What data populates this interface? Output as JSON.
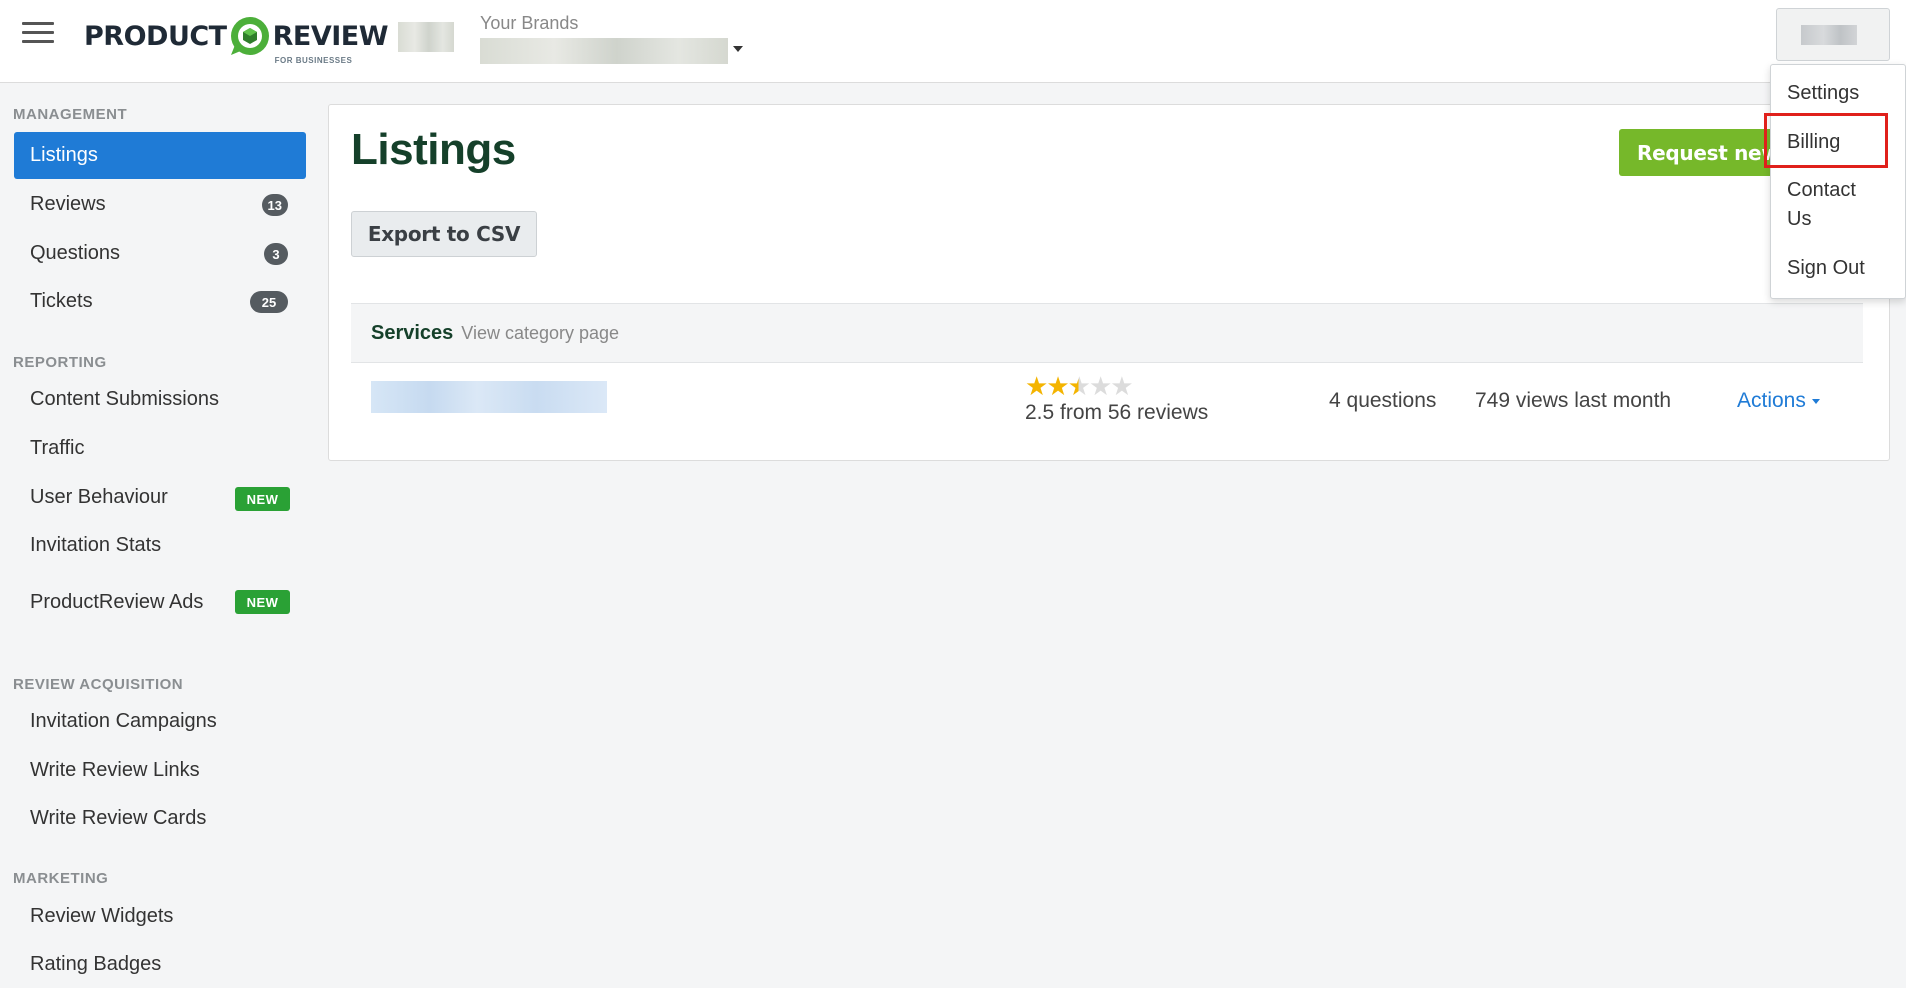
{
  "header": {
    "logo_left": "PRODUCT",
    "logo_right": "REVIEW",
    "logo_sub": "FOR BUSINESSES",
    "brands_label": "Your Brands"
  },
  "sidebar": {
    "sections": [
      {
        "title": "MANAGEMENT"
      },
      {
        "title": "REPORTING"
      },
      {
        "title": "REVIEW ACQUISITION"
      },
      {
        "title": "MARKETING"
      }
    ],
    "items": {
      "listings": "Listings",
      "reviews": "Reviews",
      "reviews_count": "13",
      "questions": "Questions",
      "questions_count": "3",
      "tickets": "Tickets",
      "tickets_count": "25",
      "content_submissions": "Content Submissions",
      "traffic": "Traffic",
      "user_behaviour": "User Behaviour",
      "invitation_stats": "Invitation Stats",
      "productreview_ads": "ProductReview Ads",
      "new_badge": "NEW",
      "invitation_campaigns": "Invitation Campaigns",
      "write_review_links": "Write Review Links",
      "write_review_cards": "Write Review Cards",
      "review_widgets": "Review Widgets",
      "rating_badges": "Rating Badges"
    }
  },
  "main": {
    "title": "Listings",
    "export_button": "Export to CSV",
    "request_button": "Request new",
    "category_name": "Services",
    "category_link": "View category page",
    "listing": {
      "rating": 2.5,
      "rating_text": "2.5 from 56 reviews",
      "questions": "4 questions",
      "views": "749 views last month",
      "actions": "Actions"
    }
  },
  "dropdown": {
    "settings": "Settings",
    "billing": "Billing",
    "contact_line1": "Contact",
    "contact_line2": "Us",
    "sign_out": "Sign Out"
  },
  "colors": {
    "primary_blue": "#1f7bd6",
    "green_button": "#76b82a",
    "new_badge": "#2aa135",
    "title_green": "#15402a",
    "highlight_red": "#e0201b"
  }
}
